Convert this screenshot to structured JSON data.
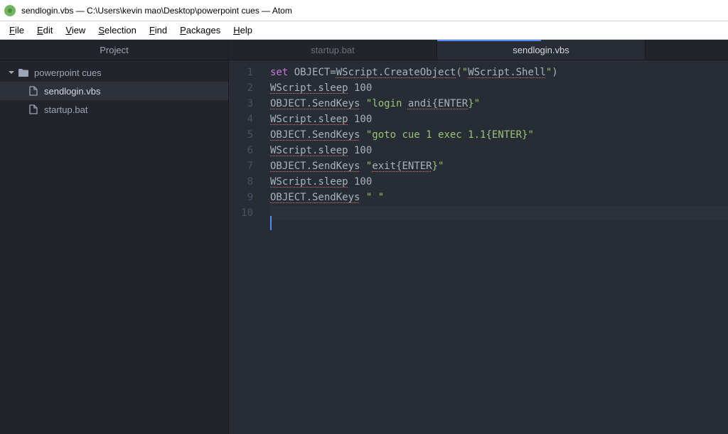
{
  "window": {
    "title": "sendlogin.vbs — C:\\Users\\kevin mao\\Desktop\\powerpoint cues — Atom"
  },
  "menu": {
    "items": [
      {
        "accel": "F",
        "rest": "ile"
      },
      {
        "accel": "E",
        "rest": "dit"
      },
      {
        "accel": "V",
        "rest": "iew"
      },
      {
        "accel": "S",
        "rest": "election"
      },
      {
        "accel": "F",
        "rest": "ind"
      },
      {
        "accel": "P",
        "rest": "ackages"
      },
      {
        "accel": "H",
        "rest": "elp"
      }
    ]
  },
  "project": {
    "header": "Project",
    "root": "powerpoint cues",
    "files": [
      "sendlogin.vbs",
      "startup.bat"
    ],
    "selected": "sendlogin.vbs"
  },
  "tabs": {
    "items": [
      "startup.bat",
      "sendlogin.vbs"
    ],
    "active": "sendlogin.vbs"
  },
  "editor": {
    "lines": [
      {
        "n": 1,
        "tokens": [
          {
            "t": "set",
            "c": "tok-kw"
          },
          {
            "t": " OBJECT=",
            "c": "tok-plain"
          },
          {
            "t": "WScript.CreateObject",
            "c": "tok-err"
          },
          {
            "t": "(",
            "c": "tok-plain"
          },
          {
            "t": "\"",
            "c": "tok-str"
          },
          {
            "t": "WScript.Shell",
            "c": "tok-err2"
          },
          {
            "t": "\"",
            "c": "tok-str"
          },
          {
            "t": ")",
            "c": "tok-plain"
          }
        ]
      },
      {
        "n": 2,
        "tokens": [
          {
            "t": "WScript.sleep",
            "c": "tok-err"
          },
          {
            "t": " 100",
            "c": "tok-plain"
          }
        ]
      },
      {
        "n": 3,
        "tokens": [
          {
            "t": "OBJECT.SendKeys",
            "c": "tok-err"
          },
          {
            "t": " ",
            "c": "tok-plain"
          },
          {
            "t": "\"login ",
            "c": "tok-str"
          },
          {
            "t": "andi{ENTER",
            "c": "tok-err2"
          },
          {
            "t": "}\"",
            "c": "tok-str"
          }
        ]
      },
      {
        "n": 4,
        "tokens": [
          {
            "t": "WScript.sleep",
            "c": "tok-err"
          },
          {
            "t": " 100",
            "c": "tok-plain"
          }
        ]
      },
      {
        "n": 5,
        "tokens": [
          {
            "t": "OBJECT.SendKeys",
            "c": "tok-err"
          },
          {
            "t": " ",
            "c": "tok-plain"
          },
          {
            "t": "\"goto cue 1 exec 1.1{ENTER}\"",
            "c": "tok-str"
          }
        ]
      },
      {
        "n": 6,
        "tokens": [
          {
            "t": "WScript.sleep",
            "c": "tok-err"
          },
          {
            "t": " 100",
            "c": "tok-plain"
          }
        ]
      },
      {
        "n": 7,
        "tokens": [
          {
            "t": "OBJECT.SendKeys",
            "c": "tok-err"
          },
          {
            "t": " ",
            "c": "tok-plain"
          },
          {
            "t": "\"",
            "c": "tok-str"
          },
          {
            "t": "exit{ENTER",
            "c": "tok-err2"
          },
          {
            "t": "}\"",
            "c": "tok-str"
          }
        ]
      },
      {
        "n": 8,
        "tokens": [
          {
            "t": "WScript.sleep",
            "c": "tok-err"
          },
          {
            "t": " 100",
            "c": "tok-plain"
          }
        ]
      },
      {
        "n": 9,
        "tokens": [
          {
            "t": "OBJECT.SendKeys",
            "c": "tok-err"
          },
          {
            "t": " ",
            "c": "tok-plain"
          },
          {
            "t": "\" \"",
            "c": "tok-str"
          }
        ]
      },
      {
        "n": 10,
        "cursor": true,
        "tokens": []
      }
    ]
  }
}
